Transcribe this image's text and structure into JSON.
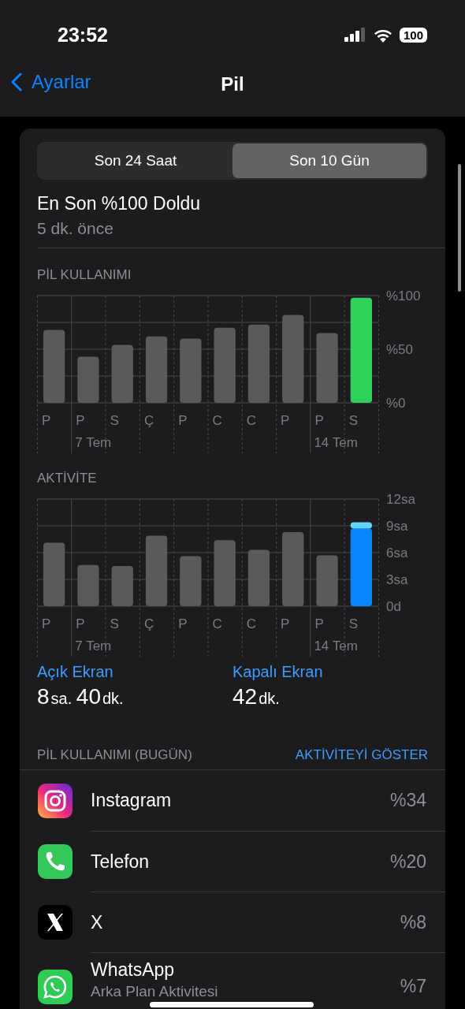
{
  "status_bar": {
    "time": "23:52",
    "battery": "100"
  },
  "nav": {
    "back": "Ayarlar",
    "title": "Pil"
  },
  "tabs": [
    {
      "label": "Son 24 Saat",
      "selected": false
    },
    {
      "label": "Son 10 Gün",
      "selected": true
    }
  ],
  "last_charge": {
    "title": "En Son %100 Doldu",
    "subtitle": "5 dk. önce"
  },
  "charts": [
    {
      "label": "PİL KULLANIMI",
      "chart_data": {
        "type": "bar",
        "stacked": true,
        "grid": true,
        "categories": [
          "P",
          "P",
          "S",
          "Ç",
          "P",
          "C",
          "C",
          "P",
          "P",
          "S"
        ],
        "series": [
          {
            "color": "#5a5a5c",
            "values": [
              68,
              43,
              54,
              62,
              60,
              70,
              73,
              82,
              65,
              null
            ]
          },
          {
            "color": "#30d158",
            "values": [
              null,
              null,
              null,
              null,
              null,
              null,
              null,
              null,
              null,
              98
            ]
          }
        ],
        "ylim": [
          0,
          100
        ],
        "yticks": [
          {
            "value": 0,
            "label": "%0"
          },
          {
            "value": 50,
            "label": "%50"
          },
          {
            "value": 100,
            "label": "%100"
          }
        ]
      },
      "weeks": [
        "7 Tem",
        "14 Tem"
      ]
    },
    {
      "label": "AKTİVİTE",
      "chart_data": {
        "type": "bar",
        "stacked": true,
        "grid": true,
        "categories": [
          "P",
          "P",
          "S",
          "Ç",
          "P",
          "C",
          "C",
          "P",
          "P",
          "S"
        ],
        "series": [
          {
            "color": "#5a5a5c",
            "values": [
              7.1,
              4.6,
              4.5,
              7.9,
              5.6,
              7.4,
              6.3,
              8.3,
              5.7,
              null
            ]
          },
          {
            "color": "#0a84ff",
            "values": [
              null,
              null,
              null,
              null,
              null,
              null,
              null,
              null,
              null,
              8.7
            ]
          },
          {
            "color": "#64d2ff",
            "values": [
              null,
              null,
              null,
              null,
              null,
              null,
              null,
              null,
              null,
              0.7
            ]
          }
        ],
        "ylim": [
          0,
          12
        ],
        "yticks": [
          {
            "value": 0,
            "label": "0d"
          },
          {
            "value": 3,
            "label": "3sa"
          },
          {
            "value": 6,
            "label": "6sa"
          },
          {
            "value": 9,
            "label": "9sa"
          },
          {
            "value": 12,
            "label": "12sa"
          }
        ]
      },
      "weeks": [
        "7 Tem",
        "14 Tem"
      ]
    }
  ],
  "screen_time": [
    {
      "label": "Açık Ekran",
      "value": [
        {
          "num": "8",
          "unit": "sa."
        },
        {
          "num": "40",
          "unit": "dk."
        }
      ]
    },
    {
      "label": "Kapalı Ekran",
      "value": [
        {
          "num": "42",
          "unit": "dk."
        }
      ]
    }
  ],
  "usage_header": {
    "title": "PİL KULLANIMI (BUGÜN)",
    "action": "AKTİVİTEYİ GÖSTER"
  },
  "apps": [
    {
      "kind": "instagram",
      "name": "Instagram",
      "percent": "%34"
    },
    {
      "kind": "phone",
      "name": "Telefon",
      "percent": "%20"
    },
    {
      "kind": "x",
      "name": "X",
      "percent": "%8"
    },
    {
      "kind": "whatsapp",
      "name": "WhatsApp",
      "subtitle": "Arka Plan Aktivitesi",
      "percent": "%7"
    }
  ]
}
